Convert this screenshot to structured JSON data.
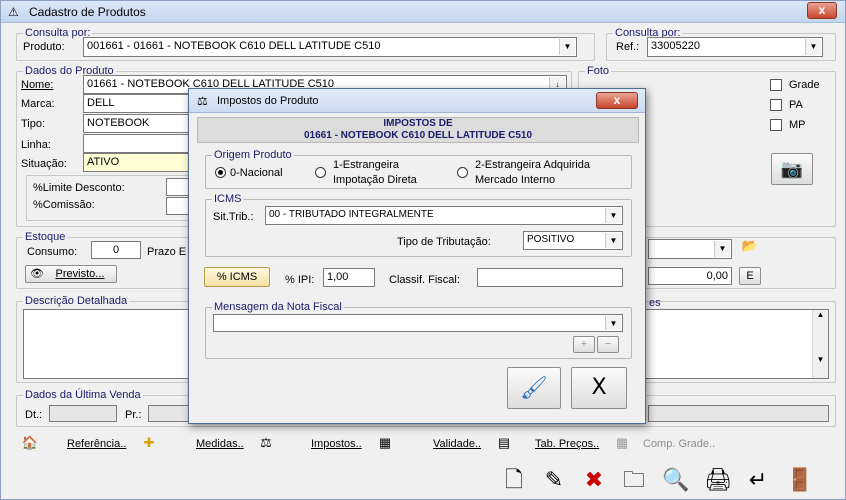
{
  "window": {
    "title": "Cadastro de Produtos",
    "close": "x"
  },
  "consulta_left": {
    "legend": "Consulta por:",
    "label": "Produto:",
    "value": "001661 - 01661 - NOTEBOOK  C610    DELL  LATITUDE C510"
  },
  "consulta_right": {
    "legend": "Consulta por:",
    "label": "Ref.:",
    "value": "33005220"
  },
  "dados": {
    "legend": "Dados do Produto",
    "nome_label": "Nome:",
    "nome_value": "01661 - NOTEBOOK  C610    DELL  LATITUDE C510",
    "marca_label": "Marca:",
    "marca_value": "DELL",
    "tipo_label": "Tipo:",
    "tipo_value": "NOTEBOOK",
    "linha_label": "Linha:",
    "linha_value": "",
    "situacao_label": "Situação:",
    "situacao_value": "ATIVO",
    "limite_label": "%Limite Desconto:",
    "comissao_label": "%Comissão:"
  },
  "foto": {
    "legend": "Foto",
    "options": [
      {
        "label": "Grade"
      },
      {
        "label": "PA"
      },
      {
        "label": "MP"
      }
    ]
  },
  "estoque": {
    "legend": "Estoque",
    "consumo_label": "Consumo:",
    "consumo_value": "0",
    "prazo_label": "Prazo E",
    "previsto_label": "Previsto...",
    "value_right": "0,00",
    "e_button": "E"
  },
  "descricao": {
    "legend": "Descrição Detalhada",
    "legend_right": "es"
  },
  "ultima_venda": {
    "legend": "Dados da Última Venda",
    "dt_label": "Dt.:",
    "pr_label": "Pr.:"
  },
  "toolbar": {
    "items": [
      {
        "label": "Referência..",
        "icon": "reference-icon"
      },
      {
        "label": "Medidas..",
        "icon": "measure-icon"
      },
      {
        "label": "Impostos..",
        "icon": "tax-icon"
      },
      {
        "label": "Validade..",
        "icon": "validity-icon"
      },
      {
        "label": "Tab. Preços..",
        "icon": "price-table-icon"
      },
      {
        "label": "Comp. Grade..",
        "icon": "grid-icon"
      }
    ]
  },
  "dialog": {
    "title": "Impostos do Produto",
    "close": "x",
    "header_line1": "IMPOSTOS DE",
    "header_line2": "01661 - NOTEBOOK  C610     DELL  LATITUDE C510",
    "origem": {
      "legend": "Origem Produto",
      "options": [
        {
          "label": "0-Nacional",
          "selected": true
        },
        {
          "label": "1-Estrangeira Impotação Direta",
          "line1": "1-Estrangeira",
          "line2": "Impotação Direta",
          "selected": false
        },
        {
          "label": "2-Estrangeira Adquirida Mercado Interno",
          "line1": "2-Estrangeira Adquirida",
          "line2": "Mercado Interno",
          "selected": false
        }
      ]
    },
    "icms": {
      "legend": "ICMS",
      "sittrib_label": "Sit.Trib.:",
      "sittrib_value": "00 - TRIBUTADO INTEGRALMENTE",
      "tipo_label": "Tipo de Tributação:",
      "tipo_value": "POSITIVO"
    },
    "icms_button": "% ICMS",
    "ipi_label": "% IPI:",
    "ipi_value": "1,00",
    "classif_label": "Classif. Fiscal:",
    "classif_value": "",
    "mensagem": {
      "legend": "Mensagem da Nota Fiscal",
      "value": "",
      "add": "+",
      "remove": "−"
    },
    "confirm_icon": "confirm-brush-icon",
    "cancel_label": "X"
  }
}
